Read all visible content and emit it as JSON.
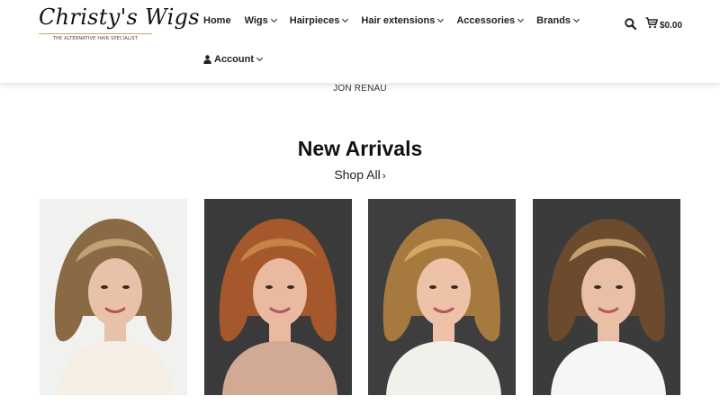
{
  "logo": {
    "text": "Christy's Wigs",
    "tagline": "THE ALTERNATIVE HAIR SPECIALIST"
  },
  "nav": {
    "items": [
      {
        "label": "Home",
        "dropdown": false
      },
      {
        "label": "Wigs",
        "dropdown": true
      },
      {
        "label": "Hairpieces",
        "dropdown": true
      },
      {
        "label": "Hair extensions",
        "dropdown": true
      },
      {
        "label": "Accessories",
        "dropdown": true
      },
      {
        "label": "Brands",
        "dropdown": true
      }
    ],
    "account_label": "Account"
  },
  "cart": {
    "total": "$0.00"
  },
  "brand_link": "JON RENAU",
  "new_arrivals": {
    "title": "New Arrivals",
    "shop_all": "Shop All",
    "shop_all_arrow": "›"
  },
  "products": [
    {
      "bg": "#f1f1f0",
      "hair": "#8a6a45",
      "hair_light": "#c9ab7d",
      "skin": "#e8c2a8",
      "top": "#f4eee4"
    },
    {
      "bg": "#3a3a3a",
      "hair": "#a4582b",
      "hair_light": "#d08a4c",
      "skin": "#e9b9a0",
      "top": "#d2a994"
    },
    {
      "bg": "#3e3e3e",
      "hair": "#a67a3e",
      "hair_light": "#d9b06a",
      "skin": "#eec2a6",
      "top": "#f2f0ea"
    },
    {
      "bg": "#3b3b3b",
      "hair": "#6b4a2e",
      "hair_light": "#d4b079",
      "skin": "#e9c0a6",
      "top": "#f6f6f4"
    }
  ],
  "colors": {
    "text": "#111111",
    "gold_rule": "#c8a86a"
  }
}
